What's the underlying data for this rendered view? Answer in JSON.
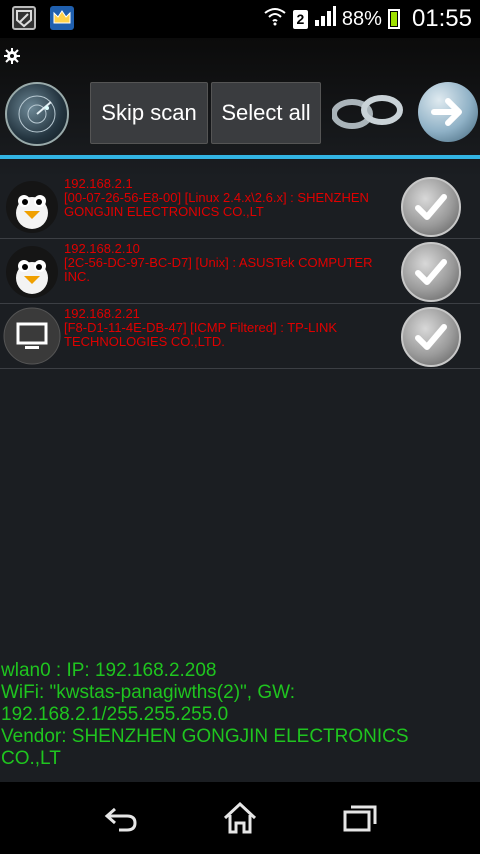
{
  "status_bar": {
    "sim_slot": "2",
    "battery": "88%",
    "battery_level": 0.88,
    "time": "01:55",
    "left_icons": [
      "shield-app-icon",
      "crown-app-icon"
    ],
    "right_icons": [
      "wifi-icon",
      "signal-icon",
      "battery-icon"
    ]
  },
  "toolbar": {
    "skip_label": "Skip scan",
    "select_label": "Select all"
  },
  "hosts": [
    {
      "ip": "192.168.2.1",
      "details": "[00-07-26-56-E8-00] [Linux 2.4.x\\2.6.x] : SHENZHEN GONGJIN ELECTRONICS CO.,LT",
      "icon": "penguin-icon",
      "checked": true
    },
    {
      "ip": "192.168.2.10",
      "details": "[2C-56-DC-97-BC-D7] [Unix] : ASUSTek COMPUTER INC.",
      "icon": "penguin-icon",
      "checked": true
    },
    {
      "ip": "192.168.2.21",
      "details": "[F8-D1-11-4E-DB-47] [ICMP Filtered] : TP-LINK TECHNOLOGIES CO.,LTD.",
      "icon": "monitor-icon",
      "checked": true
    }
  ],
  "footer": {
    "line1": "wlan0 : IP: 192.168.2.208",
    "line2": "WiFi: \"kwstas-panagiwths(2)\", GW:",
    "line3": "192.168.2.1/255.255.255.0",
    "line4": "Vendor: SHENZHEN GONGJIN ELECTRONICS",
    "line5": "CO.,LT"
  },
  "colors": {
    "accent": "#33b5e5",
    "host_text": "#e00000",
    "footer_text": "#1fc51f"
  }
}
